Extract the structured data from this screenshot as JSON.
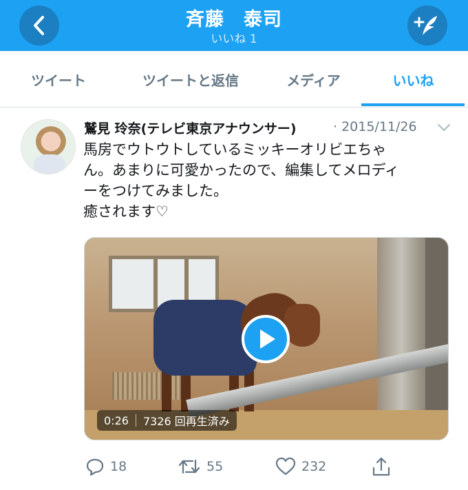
{
  "header": {
    "title": "斉藤　泰司",
    "subtitle": "いいね 1",
    "back_icon": "chevron-left-icon",
    "compose_icon": "compose-tweet-icon",
    "background_color": "#1da1f2"
  },
  "tabs": [
    {
      "label": "ツイート"
    },
    {
      "label": "ツイートと返信"
    },
    {
      "label": "メディア"
    },
    {
      "label": "いいね",
      "active": true
    }
  ],
  "tweet": {
    "author": "鷲見 玲奈(テレビ東京アナウンサー)",
    "date": "· 2015/11/26",
    "text_lines": [
      "馬房でウトウトしているミッキーオリビエちゃ",
      "ん。あまりに可愛かったので、編集してメロディ",
      "ーをつけてみました。",
      "癒されます♡"
    ],
    "video": {
      "duration": "0:26",
      "views": "7326 回再生済み"
    },
    "actions": {
      "replies": "18",
      "retweets": "55",
      "likes": "232"
    }
  },
  "colors": {
    "accent": "#1da1f2",
    "muted": "#657786"
  }
}
